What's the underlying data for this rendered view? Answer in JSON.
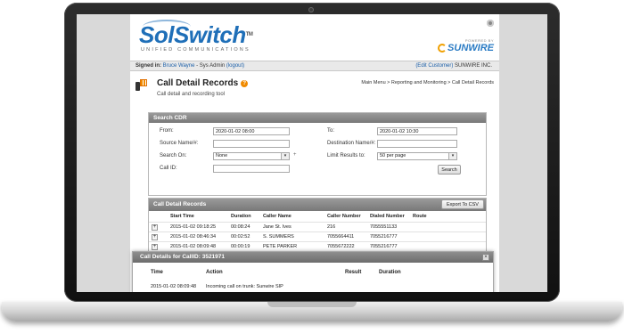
{
  "header": {
    "logo_text": "SolSwitch",
    "logo_tm": "TM",
    "logo_subtitle": "UNIFIED COMMUNICATIONS",
    "partner_tagline": "POWERED BY",
    "partner_name": "SUNWIRE"
  },
  "user_bar": {
    "signed_in_label": "Signed in:",
    "user_name": "Bruce Wayne",
    "role": "- Sys Admin",
    "logout": "(logout)",
    "edit_customer": "(Edit Customer)",
    "customer_name": "SUNWIRE INC."
  },
  "page": {
    "title": "Call Detail Records",
    "subtitle": "Call detail and recording tool",
    "help_glyph": "?",
    "breadcrumb": "Main Menu > Reporting and Monitoring > Call Detail Records"
  },
  "search": {
    "title": "Search CDR",
    "from_label": "From:",
    "from_value": "2020-01-02 08:00",
    "to_label": "To:",
    "to_value": "2020-01-02 10:30",
    "source_label": "Source Name/#:",
    "source_value": "",
    "destination_label": "Destination Name/#:",
    "destination_value": "",
    "search_on_label": "Search On:",
    "search_on_value": "None",
    "limit_label": "Limit Results to:",
    "limit_value": "50 per page",
    "call_id_label": "Call ID:",
    "call_id_value": "",
    "search_button": "Search",
    "add_glyph": "+"
  },
  "cdr_table": {
    "title": "Call Detail Records",
    "export_button": "Export To CSV",
    "columns": [
      "Start Time",
      "Duration",
      "Caller Name",
      "Caller Number",
      "Dialed Number",
      "Route"
    ],
    "rows": [
      {
        "start": "2015-01-02 09:18:25",
        "duration": "00:08:24",
        "caller_name": "Jane St. Ives",
        "caller_number": "216",
        "dialed": "7055551133",
        "route": ""
      },
      {
        "start": "2015-01-02 08:46:34",
        "duration": "00:02:52",
        "caller_name": "S. SUMMERS",
        "caller_number": "7055664411",
        "dialed": "7055216777",
        "route": ""
      },
      {
        "start": "2015-01-02 08:09:48",
        "duration": "00:00:19",
        "caller_name": "PETE PARKER",
        "caller_number": "7055672222",
        "dialed": "7055216777",
        "route": ""
      }
    ],
    "expand_glyph": "+"
  },
  "details": {
    "title": "Call Details for CallID: 3521971",
    "close_glyph": "×",
    "columns": [
      "Time",
      "Action",
      "Result",
      "Duration"
    ],
    "first_row": {
      "time": "2015-01-02 08:09:48",
      "action": "Incoming call on trunk: Sunwire SIP"
    }
  },
  "colors": {
    "brand_blue": "#1f6fb8",
    "accent_orange": "#f08a00",
    "panel_header": "#888888"
  }
}
